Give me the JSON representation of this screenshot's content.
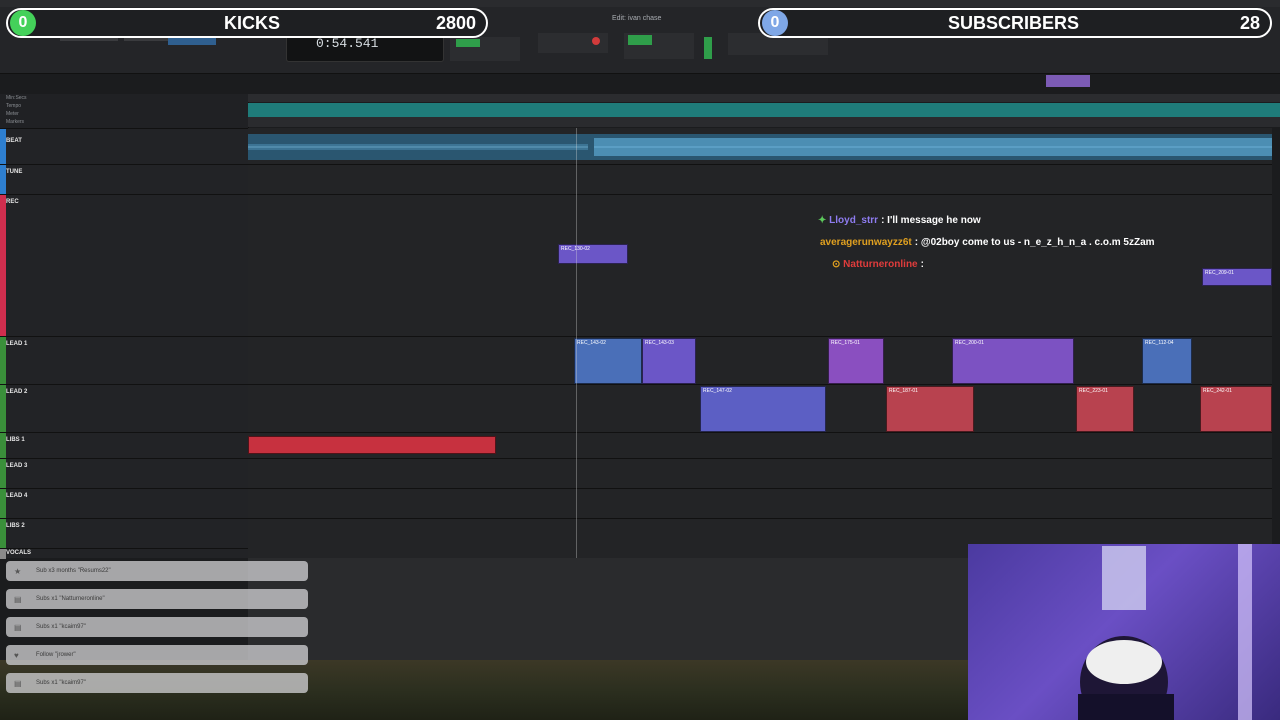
{
  "overlay": {
    "kicks": {
      "count": "0",
      "label": "KICKS",
      "value": "2800"
    },
    "subscribers": {
      "count": "0",
      "label": "SUBSCRIBERS",
      "value": "28"
    }
  },
  "daw": {
    "window_title": "Edit: ivan chase",
    "counter": "0:54.541",
    "ruler_labels": [
      "Min:Secs",
      "Tempo",
      "Meter",
      "Markers"
    ],
    "tracks": [
      {
        "name": "BEAT",
        "color": "#2e7fd0"
      },
      {
        "name": "TUNE",
        "color": "#2e7fd0"
      },
      {
        "name": "REC",
        "color": "#d02e4e"
      },
      {
        "name": "LEAD 1",
        "color": "#3a8f3a"
      },
      {
        "name": "LEAD 2",
        "color": "#3a8f3a"
      },
      {
        "name": "LIBS 1",
        "color": "#3a8f3a"
      },
      {
        "name": "LEAD 3",
        "color": "#3a8f3a"
      },
      {
        "name": "LEAD 4",
        "color": "#3a8f3a"
      },
      {
        "name": "LIBS 2",
        "color": "#3a8f3a"
      },
      {
        "name": "VOCALS",
        "color": "#8a8a8a"
      }
    ],
    "clips": [
      {
        "label": "REC_130-02",
        "color": "#6b56c7"
      },
      {
        "label": "REC_209-01",
        "color": "#6b56c7"
      },
      {
        "label": "REC_143-02",
        "color": "#4a6fb8"
      },
      {
        "label": "REC_143-03",
        "color": "#6b56c7"
      },
      {
        "label": "REC_175-01",
        "color": "#8a4fc0"
      },
      {
        "label": "REC_200-01",
        "color": "#7c52c2"
      },
      {
        "label": "REC_112-04",
        "color": "#4a6fb8"
      },
      {
        "label": "REC_147-02",
        "color": "#5c5fc4"
      },
      {
        "label": "REC_187-01",
        "color": "#b8424f"
      },
      {
        "label": "REC_223-01",
        "color": "#b8424f"
      },
      {
        "label": "REC_242-01",
        "color": "#b8424f"
      }
    ]
  },
  "chat": [
    {
      "user": "Lloyd_strr",
      "user_color": "#8e7cf0",
      "message": ": I'll message he now"
    },
    {
      "user": "averagerunwayzz6t",
      "user_color": "#e0a020",
      "message": ": @02boy come to us - n_e_z_h_n_a . c.o.m 5zZam"
    },
    {
      "user": "Natturneronline",
      "user_color": "#e03c3c",
      "message": ":"
    }
  ],
  "alerts": [
    {
      "icon": "star-icon",
      "text": "Sub x3 months \"Resums22\""
    },
    {
      "icon": "sub-icon",
      "text": "Subs x1 \"Natturneronline\""
    },
    {
      "icon": "sub-icon",
      "text": "Subs x1 \"kcaim97\""
    },
    {
      "icon": "heart-icon",
      "text": "Follow \"jrower\""
    },
    {
      "icon": "sub-icon",
      "text": "Subs x1 \"kcaim97\""
    }
  ]
}
